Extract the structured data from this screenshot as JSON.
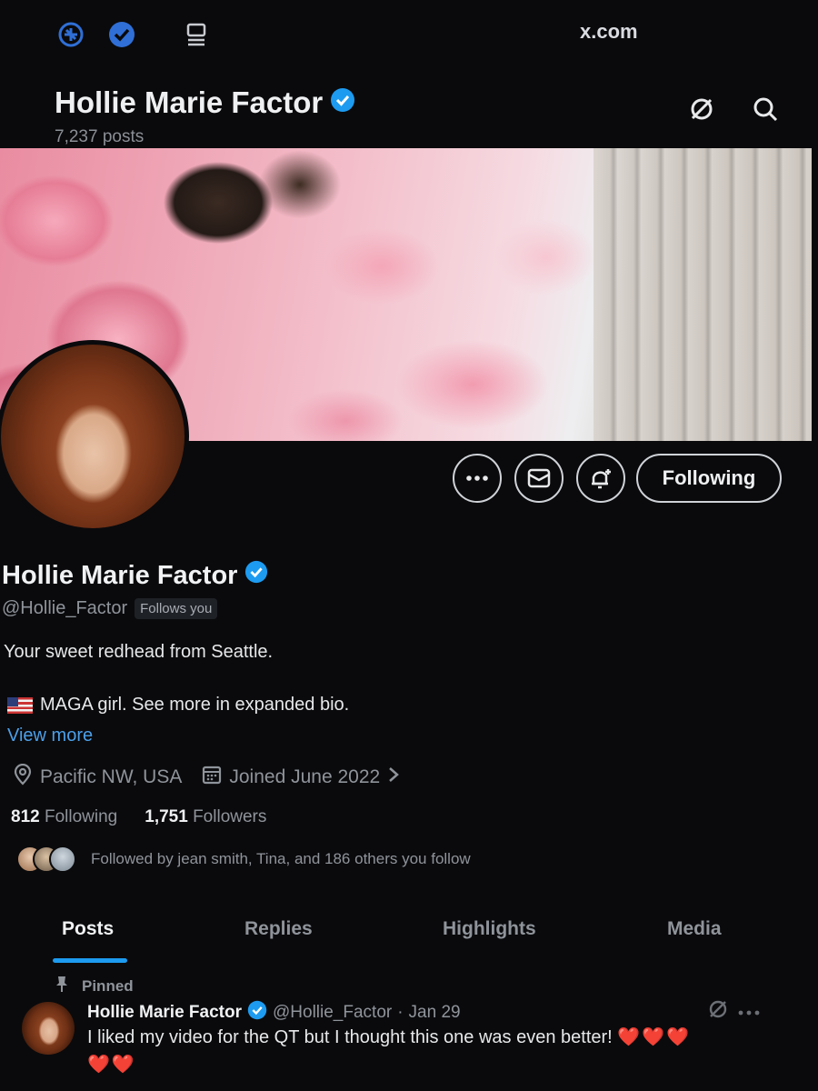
{
  "browser": {
    "url": "x.com",
    "icons": [
      "extension-icon",
      "verified-extension-icon",
      "reader-icon"
    ]
  },
  "header": {
    "name": "Hollie Marie Factor",
    "post_count": "7,237 posts"
  },
  "profile": {
    "name": "Hollie Marie Factor",
    "handle": "@Hollie_Factor",
    "follows_you": "Follows you",
    "bio_line1": "Your sweet redhead from Seattle.",
    "bio_line2": "MAGA girl.  See more in expanded bio.",
    "view_more": "View more",
    "location": "Pacific NW, USA",
    "joined": "Joined June 2022",
    "following_count": "812",
    "following_label": "Following",
    "followers_count": "1,751",
    "followers_label": "Followers",
    "followed_by": "Followed by jean smith, Tina, and 186 others you follow"
  },
  "actions": {
    "following_button": "Following"
  },
  "tabs": [
    "Posts",
    "Replies",
    "Highlights",
    "Media"
  ],
  "active_tab": "Posts",
  "post": {
    "pinned_label": "Pinned",
    "author": "Hollie Marie Factor",
    "handle": "@Hollie_Factor",
    "separator": "·",
    "date": "Jan 29",
    "text": "I liked my video for the QT but I thought this one was even better!",
    "hearts_inline": "❤️❤️❤️",
    "hearts_wrap": "❤️❤️"
  },
  "colors": {
    "accent": "#1d9bf0",
    "link": "#4c9fe8",
    "background": "#0a0a0c"
  }
}
